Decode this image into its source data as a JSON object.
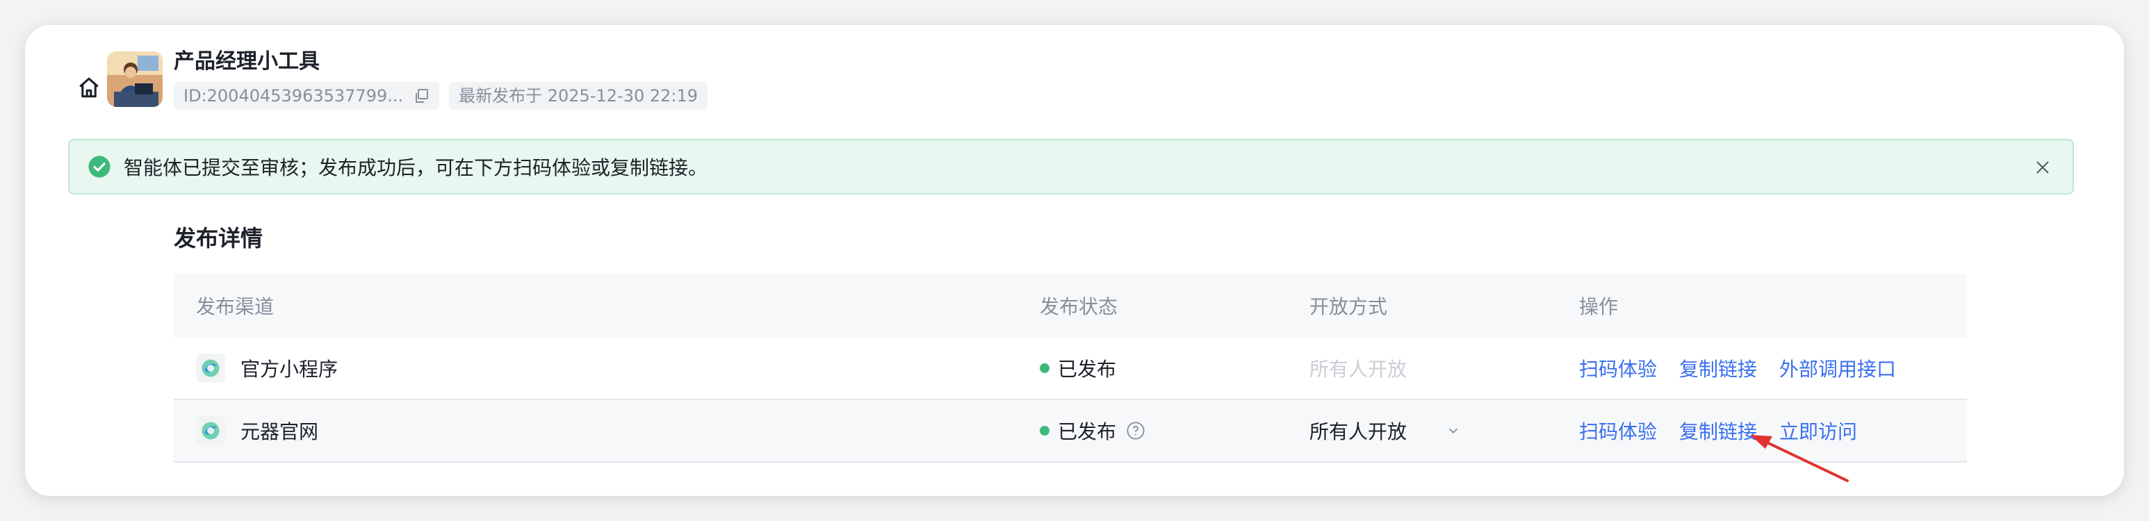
{
  "header": {
    "app_name": "产品经理小工具",
    "id_text": "ID:20040453963537799...",
    "publish_time": "最新发布于 2025-12-30 22:19"
  },
  "alert": {
    "message": "智能体已提交至审核；发布成功后，可在下方扫码体验或复制链接。",
    "status_color": "#3fb97b"
  },
  "section": {
    "title": "发布详情"
  },
  "table": {
    "headers": [
      "发布渠道",
      "发布状态",
      "开放方式",
      "操作"
    ],
    "rows": [
      {
        "channel": "官方小程序",
        "status": "已发布",
        "access": "所有人开放",
        "access_disabled": true,
        "actions": [
          "扫码体验",
          "复制链接",
          "外部调用接口"
        ]
      },
      {
        "channel": "元器官网",
        "status": "已发布",
        "access": "所有人开放",
        "access_disabled": false,
        "actions": [
          "扫码体验",
          "复制链接",
          "立即访问"
        ]
      }
    ]
  },
  "colors": {
    "accent": "#3a6ff0",
    "success": "#3fb97b",
    "annotation_arrow": "#e0332f"
  }
}
